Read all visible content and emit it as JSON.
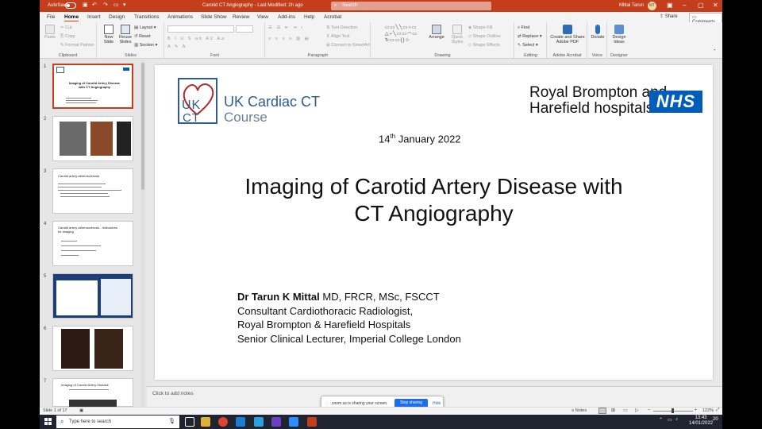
{
  "titlebar": {
    "autosave": "AutoSave",
    "toggle_state": "Off",
    "doc_title": "Carotid CT Angiography  -  Last Modified: 2h ago",
    "search_placeholder": "Search",
    "user_name": "Mittal Tarun",
    "user_initials": "MT"
  },
  "menu": {
    "items": [
      "File",
      "Home",
      "Insert",
      "Design",
      "Transitions",
      "Animations",
      "Slide Show",
      "Review",
      "View",
      "Add-ins",
      "Help",
      "Acrobat"
    ],
    "active": "Home",
    "share": "Share",
    "comments": "Comments"
  },
  "ribbon": {
    "clipboard": {
      "paste": "Paste",
      "cut": "Cut",
      "copy": "Copy",
      "format_painter": "Format Painter",
      "label": "Clipboard"
    },
    "slides": {
      "new_slide": "New Slide",
      "reuse": "Reuse Slides",
      "layout": "Layout",
      "reset": "Reset",
      "section": "Section",
      "label": "Slides"
    },
    "font": {
      "label": "Font"
    },
    "paragraph": {
      "text_direction": "Text Direction",
      "align_text": "Align Text",
      "smartart": "Convert to SmartArt",
      "label": "Paragraph"
    },
    "drawing": {
      "arrange": "Arrange",
      "quick_styles": "Quick Styles",
      "shape_fill": "Shape Fill",
      "shape_outline": "Shape Outline",
      "shape_effects": "Shape Effects",
      "label": "Drawing",
      "shapes_row1": "▭▭╲╲▭○▭",
      "shapes_row2": "△⌐╲▭▭◠▭",
      "shapes_row3": "↻▭▭{}☆"
    },
    "editing": {
      "find": "Find",
      "replace": "Replace",
      "select": "Select",
      "label": "Editing"
    },
    "acrobat": {
      "create": "Create and Share Adobe PDF",
      "label": "Adobe Acrobat"
    },
    "voice": {
      "dictate": "Dictate",
      "label": "Voice"
    },
    "designer": {
      "design_ideas": "Design Ideas",
      "label": "Designer"
    }
  },
  "thumbnails": {
    "numbers": [
      "1",
      "2",
      "3",
      "4",
      "5",
      "6",
      "7"
    ],
    "slide1_title": "Imaging of Carotid Artery Disease with CT Angiography",
    "slide3_title": "Carotid artery atherosclerosis",
    "slide4_title": "Carotid artery atherosclerosis - Indications for imaging",
    "slide7_title": "Imaging of Carotid Artery Disease"
  },
  "slide": {
    "logo_uk": "UK",
    "logo_ct": "CT",
    "logo_line1": "UK Cardiac CT",
    "logo_line2": "Course",
    "hospital_line1": "Royal Brompton and",
    "hospital_line2": "Harefield hospitals",
    "nhs": "NHS",
    "date_day": "14",
    "date_suffix": "th",
    "date_rest": " January 2022",
    "title_line1": "Imaging of Carotid Artery Disease with",
    "title_line2": "CT Angiography",
    "author_name": "Dr Tarun K Mittal",
    "author_quals": " MD, FRCR, MSc, FSCCT",
    "author_line2": "Consultant Cardiothoracic Radiologist,",
    "author_line3": "Royal Brompton & Harefield Hospitals",
    "author_line4": "Senior Clinical Lecturer, Imperial College London"
  },
  "notes": {
    "placeholder": "Click to add notes"
  },
  "status": {
    "slide_of": "Slide 1 of 17",
    "notes": "Notes",
    "zoom": "122%"
  },
  "zoom_share": {
    "message": "zoom.us is sharing your screen.",
    "stop": "Stop sharing",
    "hide": "Hide"
  },
  "taskbar": {
    "search_placeholder": "Type here to search",
    "time": "13:43",
    "date": "14/01/2022",
    "notif_count": "20"
  },
  "colors": {
    "accent": "#c43e1c",
    "nhs_blue": "#005eb8",
    "logo_blue": "#2d5e8e"
  }
}
